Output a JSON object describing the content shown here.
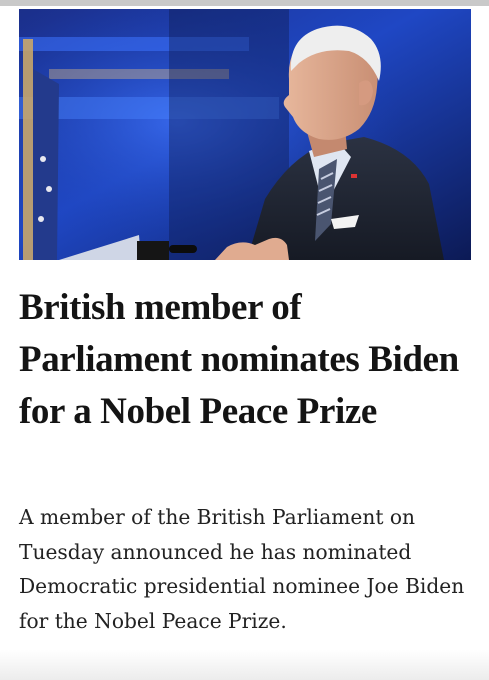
{
  "article": {
    "headline": "British member of Parliament nominates Biden for a Nobel Peace Prize",
    "dek": "A member of the British Parliament on Tuesday announced he has nominated Democratic presidential nominee Joe Biden for the Nobel Peace Prize."
  },
  "colors": {
    "headline_text": "#141414",
    "body_text": "#222222",
    "photo_backdrop": "#1a3fb0"
  },
  "photo": {
    "icon": "photo-speaker-at-podium"
  }
}
